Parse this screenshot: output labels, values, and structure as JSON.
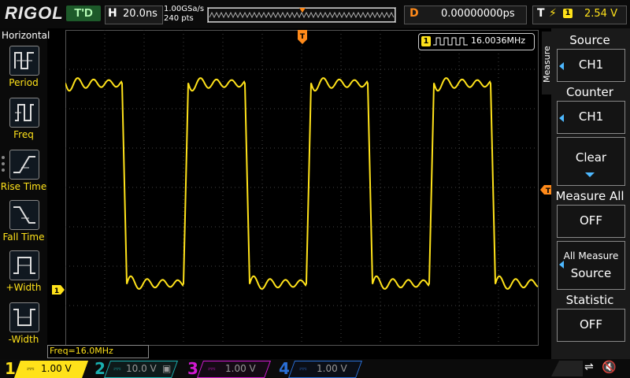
{
  "topbar": {
    "logo": "RIGOL",
    "trigger_status": "T'D",
    "h_label": "H",
    "timebase": "20.0ns",
    "sample_rate": "1.00GSa/s",
    "mem_depth": "240  pts",
    "d_label": "D",
    "horizontal_offset": "0.00000000ps",
    "t_label": "T",
    "trigger_source": "1",
    "trigger_level": "2.54 V"
  },
  "left_menu": {
    "title": "Horizontal",
    "items": [
      {
        "label": "Period"
      },
      {
        "label": "Freq"
      },
      {
        "label": "Rise Time"
      },
      {
        "label": "Fall Time"
      },
      {
        "label": "+Width"
      },
      {
        "label": "-Width"
      }
    ]
  },
  "measurement": {
    "channel": "1",
    "value": "16.0036MHz"
  },
  "freq_readout": "Freq=16.0MHz",
  "channels": [
    {
      "num": "1",
      "scale": "1.00 V",
      "color": "#ffe21a"
    },
    {
      "num": "2",
      "scale": "10.0 V",
      "color": "#1ab0b0"
    },
    {
      "num": "3",
      "scale": "1.00 V",
      "color": "#d21ad2"
    },
    {
      "num": "4",
      "scale": "1.00 V",
      "color": "#2a6fd6"
    }
  ],
  "right_menu": {
    "side_label": "Measure",
    "source_title": "Source",
    "source_value": "CH1",
    "counter_title": "Counter",
    "counter_value": "CH1",
    "clear_label": "Clear",
    "measure_all_title": "Measure All",
    "measure_all_value": "OFF",
    "all_measure_line1": "All Measure",
    "all_measure_line2": "Source",
    "statistic_title": "Statistic",
    "statistic_value": "OFF"
  },
  "colors": {
    "ch1": "#ffe21a",
    "trigger_marker": "#ff8a1a",
    "trigger_status_bg": "#1d5a2a",
    "accent": "#4db8ff"
  },
  "icons": {
    "usb": "usb-icon",
    "speaker": "speaker-mute-icon",
    "trigger_edge": "rising-edge-icon"
  }
}
